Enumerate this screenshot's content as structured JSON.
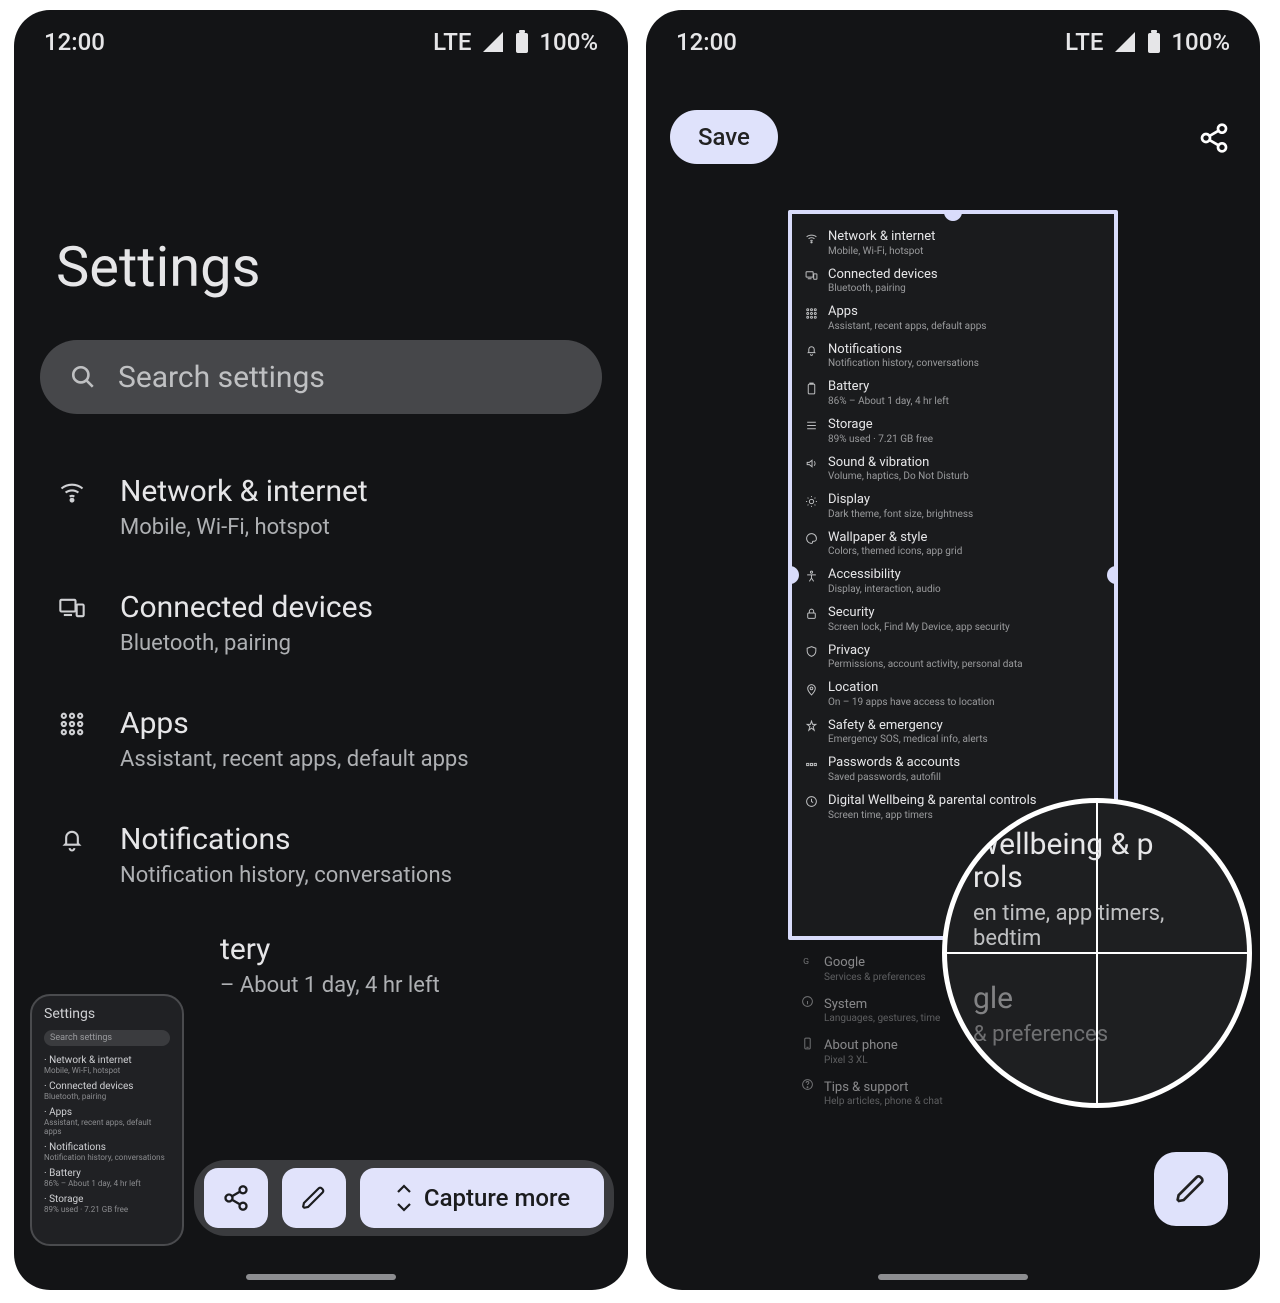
{
  "status": {
    "time": "12:00",
    "network": "LTE",
    "battery": "100%"
  },
  "left": {
    "title": "Settings",
    "search_placeholder": "Search settings",
    "items": [
      {
        "title": "Network & internet",
        "subtitle": "Mobile, Wi-Fi, hotspot",
        "icon": "wifi-icon"
      },
      {
        "title": "Connected devices",
        "subtitle": "Bluetooth, pairing",
        "icon": "devices-icon"
      },
      {
        "title": "Apps",
        "subtitle": "Assistant, recent apps, default apps",
        "icon": "apps-icon"
      },
      {
        "title": "Notifications",
        "subtitle": "Notification history, conversations",
        "icon": "bell-icon"
      }
    ],
    "battery_row": {
      "title_partial": "tery",
      "subtitle_partial": "– About 1 day, 4 hr left"
    },
    "thumb": {
      "title": "Settings",
      "search": "Search settings",
      "rows": [
        {
          "t": "Network & internet",
          "s": "Mobile, Wi-Fi, hotspot"
        },
        {
          "t": "Connected devices",
          "s": "Bluetooth, pairing"
        },
        {
          "t": "Apps",
          "s": "Assistant, recent apps, default apps"
        },
        {
          "t": "Notifications",
          "s": "Notification history, conversations"
        },
        {
          "t": "Battery",
          "s": "86% – About 1 day, 4 hr left"
        },
        {
          "t": "Storage",
          "s": "89% used · 7.21 GB free"
        }
      ]
    },
    "capture_more": "Capture more"
  },
  "right": {
    "save": "Save",
    "crop_items": [
      {
        "t": "Network & internet",
        "s": "Mobile, Wi-Fi, hotspot",
        "i": "wifi-icon"
      },
      {
        "t": "Connected devices",
        "s": "Bluetooth, pairing",
        "i": "devices-icon"
      },
      {
        "t": "Apps",
        "s": "Assistant, recent apps, default apps",
        "i": "apps-icon"
      },
      {
        "t": "Notifications",
        "s": "Notification history, conversations",
        "i": "bell-icon"
      },
      {
        "t": "Battery",
        "s": "86% – About 1 day, 4 hr left",
        "i": "battery-icon"
      },
      {
        "t": "Storage",
        "s": "89% used · 7.21 GB free",
        "i": "storage-icon"
      },
      {
        "t": "Sound & vibration",
        "s": "Volume, haptics, Do Not Disturb",
        "i": "sound-icon"
      },
      {
        "t": "Display",
        "s": "Dark theme, font size, brightness",
        "i": "display-icon"
      },
      {
        "t": "Wallpaper & style",
        "s": "Colors, themed icons, app grid",
        "i": "palette-icon"
      },
      {
        "t": "Accessibility",
        "s": "Display, interaction, audio",
        "i": "accessibility-icon"
      },
      {
        "t": "Security",
        "s": "Screen lock, Find My Device, app security",
        "i": "lock-icon"
      },
      {
        "t": "Privacy",
        "s": "Permissions, account activity, personal data",
        "i": "privacy-icon"
      },
      {
        "t": "Location",
        "s": "On – 19 apps have access to location",
        "i": "location-icon"
      },
      {
        "t": "Safety & emergency",
        "s": "Emergency SOS, medical info, alerts",
        "i": "star-icon"
      },
      {
        "t": "Passwords & accounts",
        "s": "Saved passwords, autofill",
        "i": "key-icon"
      },
      {
        "t": "Digital Wellbeing & parental controls",
        "s": "Screen time, app timers",
        "i": "wellbeing-icon"
      }
    ],
    "below_items": [
      {
        "t": "Google",
        "s": "Services & preferences",
        "i": "google-icon"
      },
      {
        "t": "System",
        "s": "Languages, gestures, time",
        "i": "info-icon"
      },
      {
        "t": "About phone",
        "s": "Pixel 3 XL",
        "i": "phone-icon"
      },
      {
        "t": "Tips & support",
        "s": "Help articles, phone & chat",
        "i": "help-icon"
      }
    ],
    "magnifier": {
      "line1": "Wellbeing & p",
      "line2": "rols",
      "line3": "en time, app timers, bedtim",
      "dim1": "gle",
      "dim2": "& preferences"
    }
  }
}
